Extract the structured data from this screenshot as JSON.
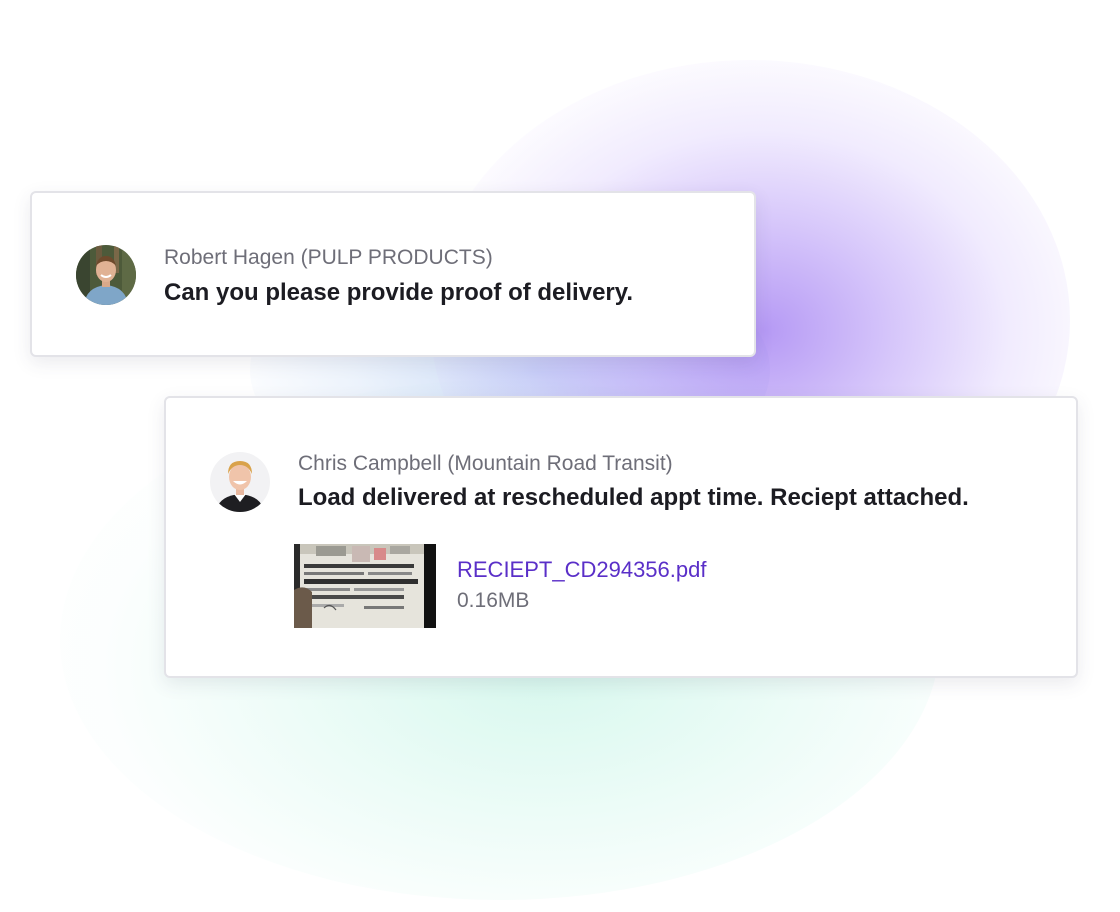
{
  "messages": [
    {
      "sender": "Robert Hagen (PULP PRODUCTS)",
      "text": "Can you please provide proof of delivery."
    },
    {
      "sender": "Chris Campbell (Mountain Road Transit)",
      "text": "Load delivered at rescheduled appt time.  Reciept attached.",
      "attachment": {
        "file_name": "RECIEPT_CD294356.pdf",
        "file_size": "0.16MB",
        "icon": "document-thumbnail"
      }
    }
  ],
  "colors": {
    "link": "#5a2fc8",
    "muted_text": "#6e6e78",
    "primary_text": "#1c1c22",
    "glow_purple": "#9a6ef0",
    "glow_green": "#b4f0dc"
  }
}
